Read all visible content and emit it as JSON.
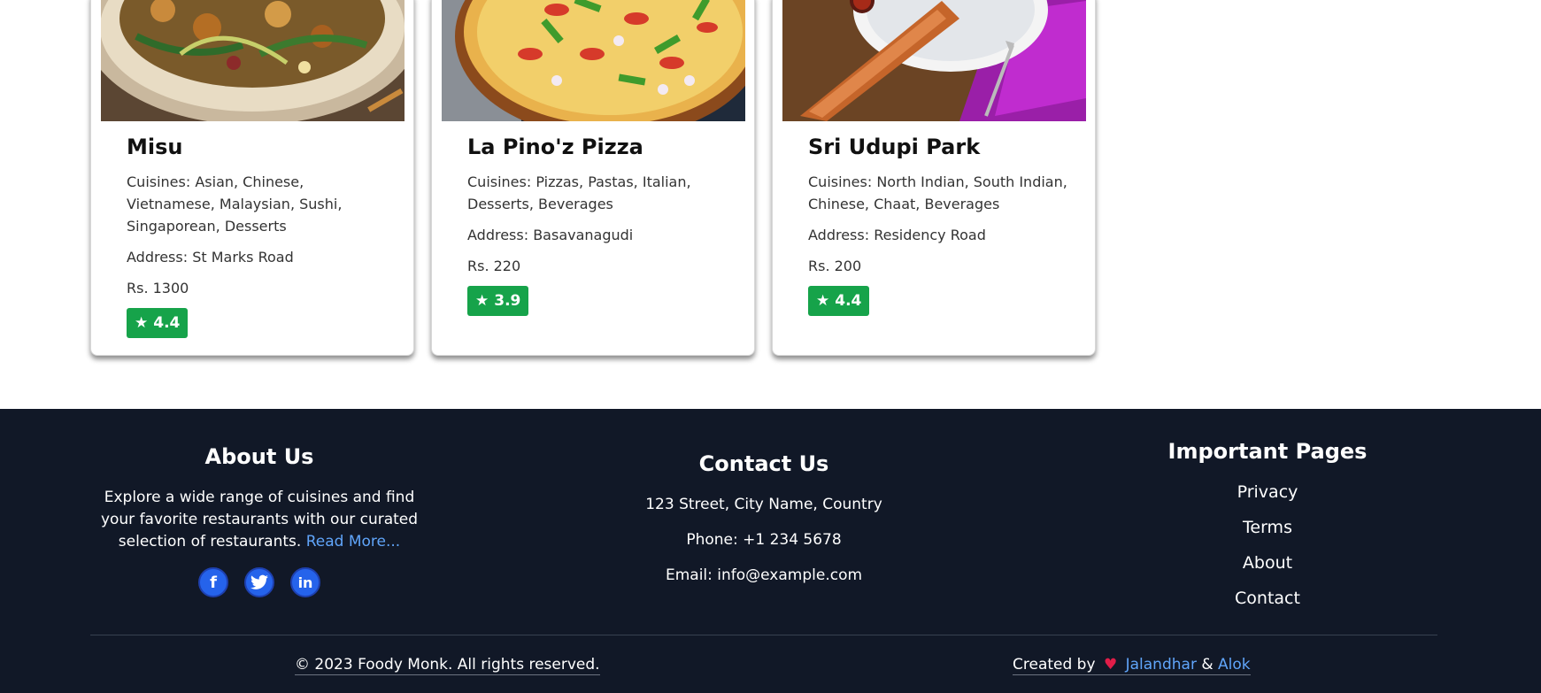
{
  "restaurants": [
    {
      "name": "Misu",
      "cuisines": "Cuisines: Asian, Chinese, Vietnamese, Malaysian, Sushi, Singaporean, Desserts",
      "address": "Address: St Marks Road",
      "price": "Rs. 1300",
      "rating": "4.4"
    },
    {
      "name": "La Pino'z Pizza",
      "cuisines": "Cuisines: Pizzas, Pastas, Italian, Desserts, Beverages",
      "address": "Address: Basavanagudi",
      "price": "Rs. 220",
      "rating": "3.9"
    },
    {
      "name": "Sri Udupi Park",
      "cuisines": "Cuisines: North Indian, South Indian, Chinese, Chaat, Beverages",
      "address": "Address: Residency Road",
      "price": "Rs. 200",
      "rating": "4.4"
    }
  ],
  "footer": {
    "about": {
      "title": "About Us",
      "text": "Explore a wide range of cuisines and find your favorite restaurants with our curated selection of restaurants.",
      "read_more": "Read More..."
    },
    "contact": {
      "title": "Contact Us",
      "address": "123 Street, City Name, Country",
      "phone": "Phone: +1 234 5678",
      "email": "Email: info@example.com"
    },
    "pages": {
      "title": "Important Pages",
      "links": [
        "Privacy",
        "Terms",
        "About",
        "Contact"
      ]
    },
    "copyright": "© 2023 Foody Monk. All rights reserved.",
    "credit_prefix": "Created by",
    "author1": "Jalandhar",
    "amp": "&",
    "author2": "Alok"
  },
  "icons": {
    "social": [
      "facebook-icon",
      "twitter-icon",
      "linkedin-icon"
    ],
    "rating": "star-icon",
    "heart": "heart-icon"
  },
  "colors": {
    "rating_badge": "#16a34a",
    "footer_bg": "#111827",
    "link": "#60a5fa",
    "heart": "#e11d48"
  }
}
